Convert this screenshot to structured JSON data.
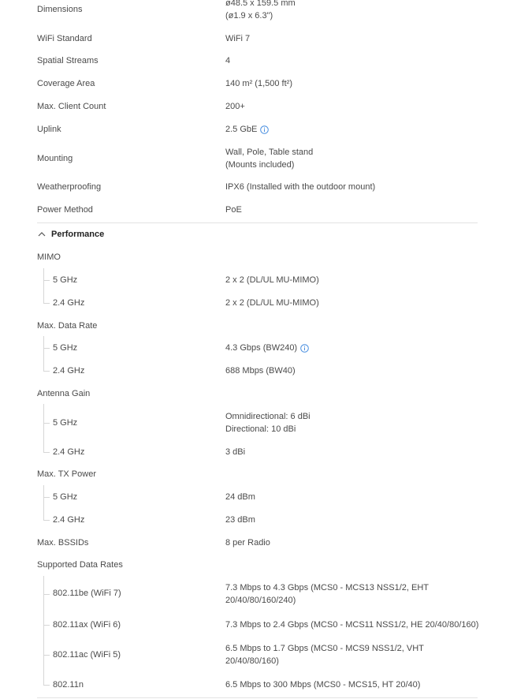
{
  "top_specs": [
    {
      "label": "Dimensions",
      "value_lines": [
        "ø48.5 x 159.5 mm",
        "(ø1.9 x 6.3\")"
      ]
    },
    {
      "label": "WiFi Standard",
      "value_lines": [
        "WiFi 7"
      ]
    },
    {
      "label": "Spatial Streams",
      "value_lines": [
        "4"
      ]
    },
    {
      "label": "Coverage Area",
      "value_lines": [
        "140 m² (1,500 ft²)"
      ]
    },
    {
      "label": "Max. Client Count",
      "value_lines": [
        "200+"
      ]
    },
    {
      "label": "Uplink",
      "value_lines": [
        "2.5 GbE"
      ],
      "info_icon": "info-icon"
    },
    {
      "label": "Mounting",
      "value_lines": [
        "Wall, Pole, Table stand",
        "(Mounts included)"
      ]
    },
    {
      "label": "Weatherproofing",
      "value_lines": [
        "IPX6 (Installed with the outdoor mount)"
      ]
    },
    {
      "label": "Power Method",
      "value_lines": [
        "PoE"
      ]
    }
  ],
  "performance": {
    "title": "Performance",
    "chevron_icon": "chevron-up-icon",
    "groups": [
      {
        "label": "MIMO",
        "items": [
          {
            "label": "5 GHz",
            "value_lines": [
              "2 x 2 (DL/UL MU-MIMO)"
            ]
          },
          {
            "label": "2.4 GHz",
            "value_lines": [
              "2 x 2 (DL/UL MU-MIMO)"
            ]
          }
        ]
      },
      {
        "label": "Max. Data Rate",
        "items": [
          {
            "label": "5 GHz",
            "value_lines": [
              "4.3 Gbps (BW240)"
            ],
            "info_icon": "info-icon"
          },
          {
            "label": "2.4 GHz",
            "value_lines": [
              "688 Mbps (BW40)"
            ]
          }
        ]
      },
      {
        "label": "Antenna Gain",
        "items": [
          {
            "label": "5 GHz",
            "value_lines": [
              "Omnidirectional: 6 dBi",
              "Directional: 10 dBi"
            ]
          },
          {
            "label": "2.4 GHz",
            "value_lines": [
              "3 dBi"
            ]
          }
        ]
      },
      {
        "label": "Max. TX Power",
        "items": [
          {
            "label": "5 GHz",
            "value_lines": [
              "24 dBm"
            ]
          },
          {
            "label": "2.4 GHz",
            "value_lines": [
              "23 dBm"
            ]
          }
        ]
      },
      {
        "label": "Max. BSSIDs",
        "value_lines": [
          "8 per Radio"
        ],
        "items": []
      },
      {
        "label": "Supported Data Rates",
        "items": [
          {
            "label": "802.11be (WiFi 7)",
            "value_lines": [
              "7.3 Mbps to 4.3 Gbps (MCS0 - MCS13 NSS1/2, EHT",
              "20/40/80/160/240)"
            ]
          },
          {
            "label": "802.11ax (WiFi 6)",
            "value_lines": [
              "7.3 Mbps to 2.4 Gbps (MCS0 - MCS11 NSS1/2, HE 20/40/80/160)"
            ]
          },
          {
            "label": "802.11ac (WiFi 5)",
            "value_lines": [
              "6.5 Mbps to 1.7 Gbps (MCS0 - MCS9 NSS1/2, VHT",
              "20/40/80/160)"
            ]
          },
          {
            "label": "802.11n",
            "value_lines": [
              "6.5 Mbps to 300 Mbps (MCS0 - MCS15, HT 20/40)"
            ]
          }
        ]
      }
    ]
  },
  "colors": {
    "info_icon": "#4a8fe0",
    "tree_line": "#d6d6d6",
    "divider": "#e3e3e3"
  }
}
